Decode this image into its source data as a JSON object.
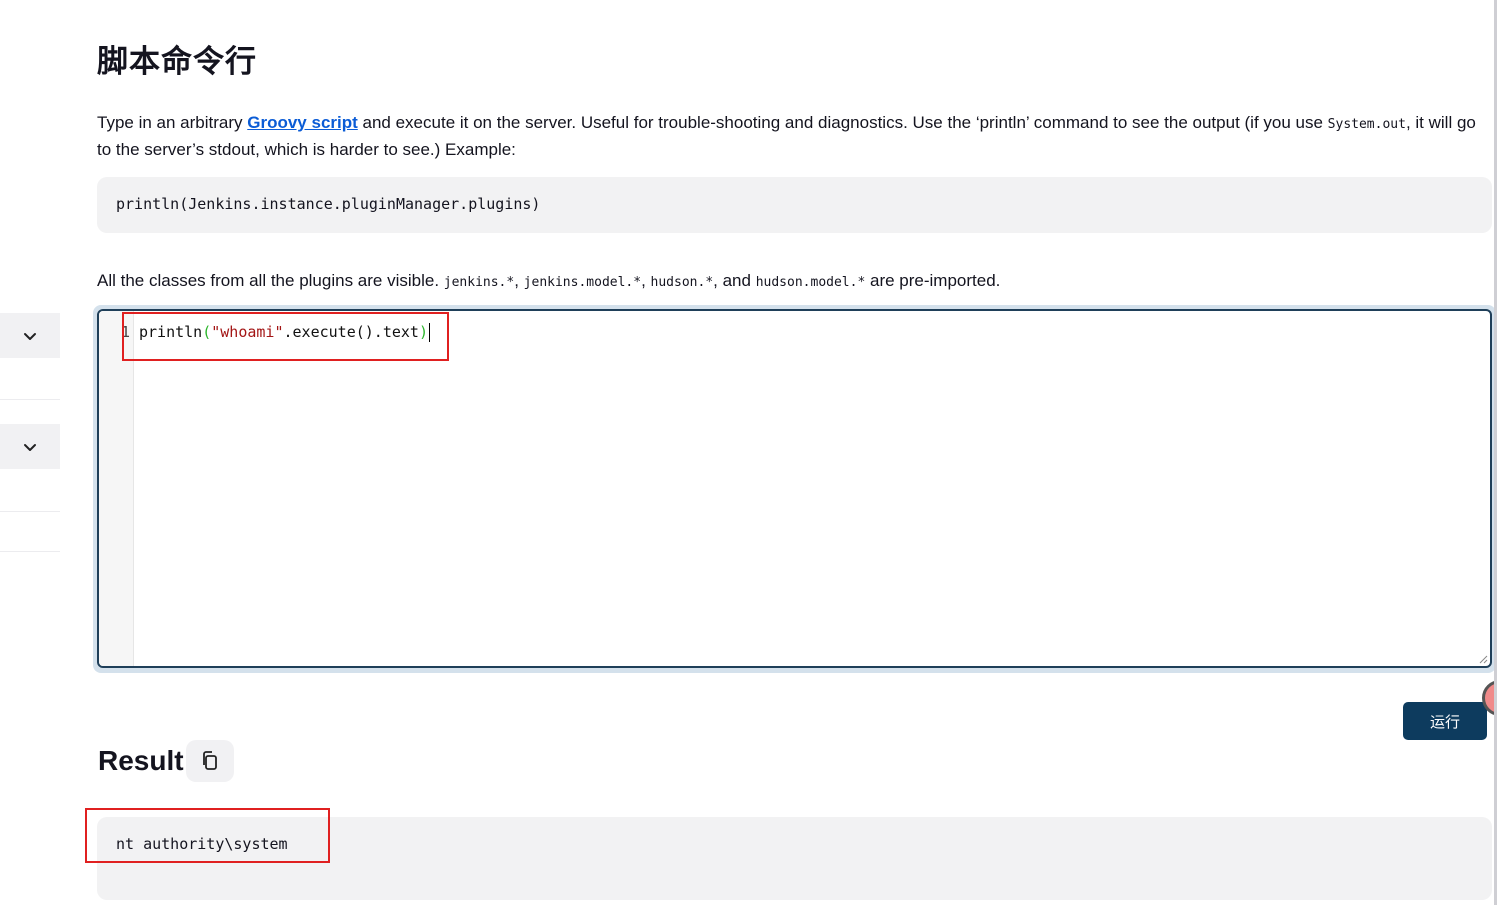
{
  "page": {
    "title": "脚本命令行"
  },
  "description": {
    "before_link": "Type in an arbitrary ",
    "link": "Groovy script",
    "after_link": " and execute it on the server. Useful for trouble-shooting and diagnostics. Use the ‘println’ command to see the output (if you use ",
    "code_system_out": "System.out",
    "after_code": ", it will go to the server’s stdout, which is harder to see.) Example:"
  },
  "example": {
    "code": "println(Jenkins.instance.pluginManager.plugins)"
  },
  "imports": {
    "prefix": "All the classes from all the plugins are visible. ",
    "pkg1": "jenkins.*",
    "sep1": ", ",
    "pkg2": "jenkins.model.*",
    "sep2": ", ",
    "pkg3": "hudson.*",
    "sep3": ", and ",
    "pkg4": "hudson.model.*",
    "suffix": " are pre-imported."
  },
  "editor": {
    "line_number": "1",
    "code_fn": "println",
    "code_open": "(",
    "code_string": "\"whoami\"",
    "code_method": ".execute().text",
    "code_close": ")"
  },
  "run_button": {
    "label": "运行"
  },
  "result": {
    "title": "Result",
    "output": "nt authority\\system"
  },
  "icons": {
    "sidebar_toggle": "chevron-down-icon",
    "copy": "copy-icon"
  },
  "colors": {
    "primary_button": "#0d3b5e",
    "link": "#0b5cd6",
    "highlight_box": "#e02020",
    "editor_border": "#1f3f59"
  }
}
